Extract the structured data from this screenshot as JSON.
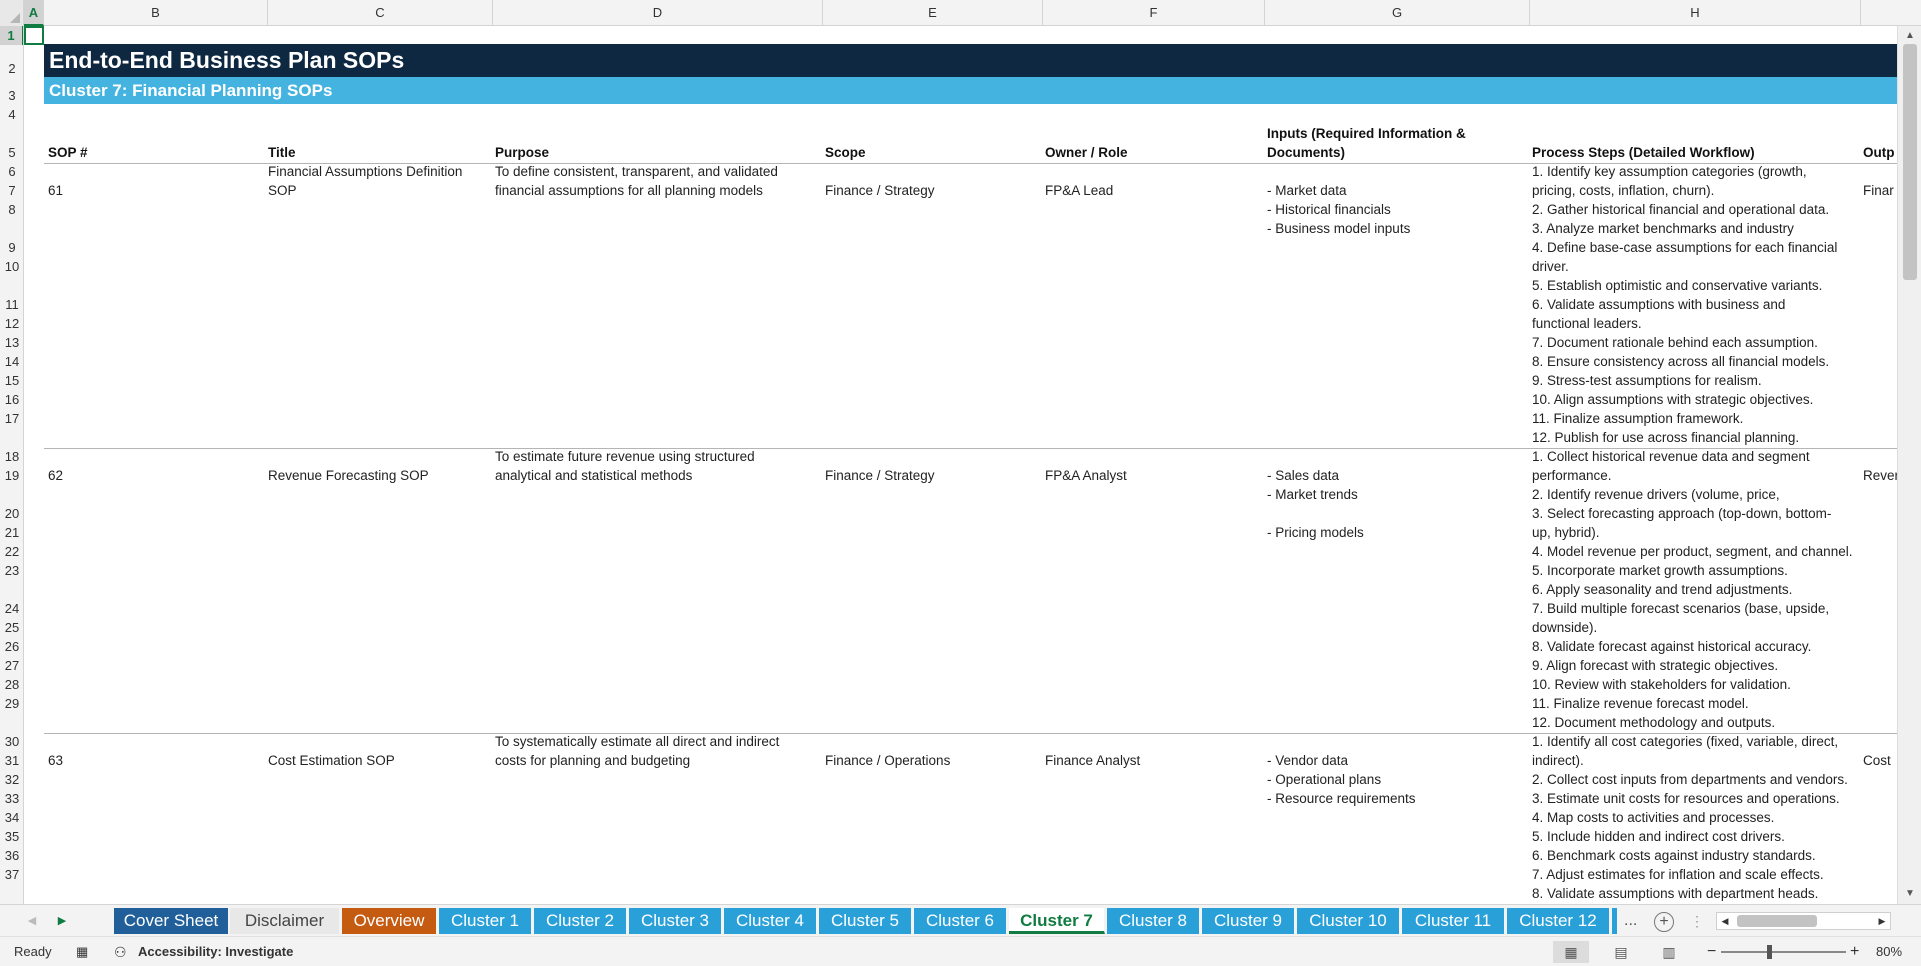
{
  "columns": [
    "A",
    "B",
    "C",
    "D",
    "E",
    "F",
    "G",
    "H"
  ],
  "rows": [
    "1",
    "2",
    "3",
    "4",
    "5",
    "6",
    "7",
    "8",
    "9",
    "10",
    "11",
    "12",
    "13",
    "14",
    "15",
    "16",
    "17",
    "18",
    "19",
    "20",
    "21",
    "22",
    "23",
    "24",
    "25",
    "26",
    "27",
    "28",
    "29",
    "30",
    "31",
    "32",
    "33",
    "34",
    "35",
    "36",
    "37"
  ],
  "sheet": {
    "title": "End-to-End Business Plan SOPs",
    "subtitle": "Cluster 7: Financial Planning SOPs",
    "headers": {
      "sop": "SOP #",
      "title": "Title",
      "purpose": "Purpose",
      "scope": "Scope",
      "owner": "Owner / Role",
      "inputs_1": "Inputs (Required Information &",
      "inputs_2": "Documents)",
      "process": "Process Steps (Detailed Workflow)",
      "output": "Outp"
    },
    "sops": [
      {
        "num": "61",
        "title": [
          "Financial Assumptions Definition",
          "SOP"
        ],
        "purpose": [
          "To define consistent, transparent, and validated",
          "financial assumptions for all planning models"
        ],
        "scope": "Finance / Strategy",
        "owner": "FP&A Lead",
        "inputs": [
          "- Market data",
          "- Historical financials",
          "- Business model inputs"
        ],
        "steps": [
          "1. Identify key assumption categories (growth,",
          "pricing, costs, inflation, churn).",
          "2. Gather historical financial and operational data.",
          "3. Analyze market benchmarks and industry",
          "4. Define base-case assumptions for each financial",
          "driver.",
          "5. Establish optimistic and conservative variants.",
          "6. Validate assumptions with business and",
          "functional leaders.",
          "7. Document rationale behind each assumption.",
          "8. Ensure consistency across all financial models.",
          "9. Stress-test assumptions for realism.",
          "10. Align assumptions with strategic objectives.",
          "11. Finalize assumption framework.",
          "12. Publish for use across financial planning."
        ],
        "output": "Finar"
      },
      {
        "num": "62",
        "title": [
          "Revenue Forecasting SOP"
        ],
        "purpose": [
          "To estimate future revenue using structured",
          "analytical and statistical methods"
        ],
        "scope": "Finance / Strategy",
        "owner": "FP&A Analyst",
        "inputs": [
          "- Sales data",
          "- Market trends",
          "",
          "- Pricing models"
        ],
        "steps": [
          "1. Collect historical revenue data and segment",
          "performance.",
          "2. Identify revenue drivers (volume, price,",
          "3. Select forecasting approach (top-down, bottom-",
          "up, hybrid).",
          "4. Model revenue per product, segment, and channel.",
          "5. Incorporate market growth assumptions.",
          "6. Apply seasonality and trend adjustments.",
          "7. Build multiple forecast scenarios (base, upside,",
          "downside).",
          "8. Validate forecast against historical accuracy.",
          "9. Align forecast with strategic objectives.",
          "10. Review with stakeholders for validation.",
          "11. Finalize revenue forecast model.",
          "12. Document methodology and outputs."
        ],
        "output": "Rever"
      },
      {
        "num": "63",
        "title": [
          "Cost Estimation SOP"
        ],
        "purpose": [
          "To systematically estimate all direct and indirect",
          "costs for planning and budgeting"
        ],
        "scope": "Finance / Operations",
        "owner": "Finance Analyst",
        "inputs": [
          "- Vendor data",
          "- Operational plans",
          "- Resource requirements"
        ],
        "steps": [
          "1. Identify all cost categories (fixed, variable, direct,",
          "indirect).",
          "2. Collect cost inputs from departments and vendors.",
          "3. Estimate unit costs for resources and operations.",
          "4. Map costs to activities and processes.",
          "5. Include hidden and indirect cost drivers.",
          "6. Benchmark costs against industry standards.",
          "7. Adjust estimates for inflation and scale effects.",
          "8. Validate assumptions with department heads."
        ],
        "output": "Cost"
      }
    ]
  },
  "tabs": [
    {
      "label": "Cover Sheet",
      "kind": "cover"
    },
    {
      "label": "Disclaimer",
      "kind": "disclaimer"
    },
    {
      "label": "Overview",
      "kind": "overview"
    },
    {
      "label": "Cluster 1",
      "kind": "cluster"
    },
    {
      "label": "Cluster 2",
      "kind": "cluster"
    },
    {
      "label": "Cluster 3",
      "kind": "cluster"
    },
    {
      "label": "Cluster 4",
      "kind": "cluster"
    },
    {
      "label": "Cluster 5",
      "kind": "cluster"
    },
    {
      "label": "Cluster 6",
      "kind": "cluster"
    },
    {
      "label": "Cluster 7",
      "kind": "active"
    },
    {
      "label": "Cluster 8",
      "kind": "cluster"
    },
    {
      "label": "Cluster 9",
      "kind": "cluster"
    },
    {
      "label": "Cluster 10",
      "kind": "cluster"
    },
    {
      "label": "Cluster 11",
      "kind": "cluster"
    },
    {
      "label": "Cluster 12",
      "kind": "cluster"
    }
  ],
  "tabbar": {
    "more": "...",
    "add": "+"
  },
  "status": {
    "ready": "Ready",
    "accessibility": "Accessibility: Investigate",
    "zoom": "80%",
    "zoom_out": "−",
    "zoom_in": "+"
  },
  "colors": {
    "title_band": "#0e2841",
    "subtitle_band": "#45b3e0",
    "cluster_tab": "#2aa0d9",
    "cover_tab": "#215f9a",
    "overview_tab": "#c55a11",
    "active_accent": "#107c41"
  }
}
